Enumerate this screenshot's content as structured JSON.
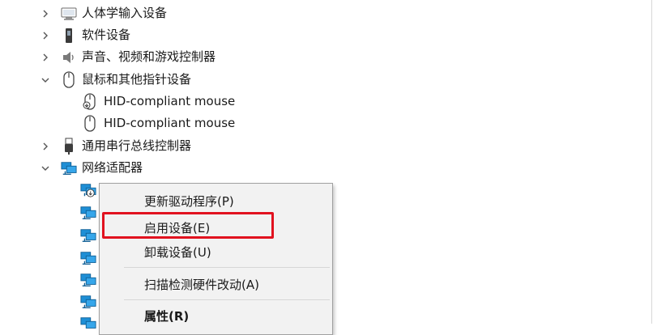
{
  "tree": {
    "hid_label": "人体学输入设备",
    "software_label": "软件设备",
    "audio_label": "声音、视频和游戏控制器",
    "mouse_label": "鼠标和其他指针设备",
    "mouse_child_1": "HID-compliant mouse",
    "mouse_child_2": "HID-compliant mouse",
    "usb_label": "通用串行总线控制器",
    "network_label": "网络适配器"
  },
  "context_menu": {
    "update_driver": "更新驱动程序(P)",
    "enable_device": "启用设备(E)",
    "uninstall_device": "卸载设备(U)",
    "scan_hardware": "扫描检测硬件改动(A)",
    "properties": "属性(R)"
  },
  "colors": {
    "highlight_border": "#e1121f",
    "menu_background": "#f2f2f2",
    "network_icon": "#1e8fd6"
  }
}
